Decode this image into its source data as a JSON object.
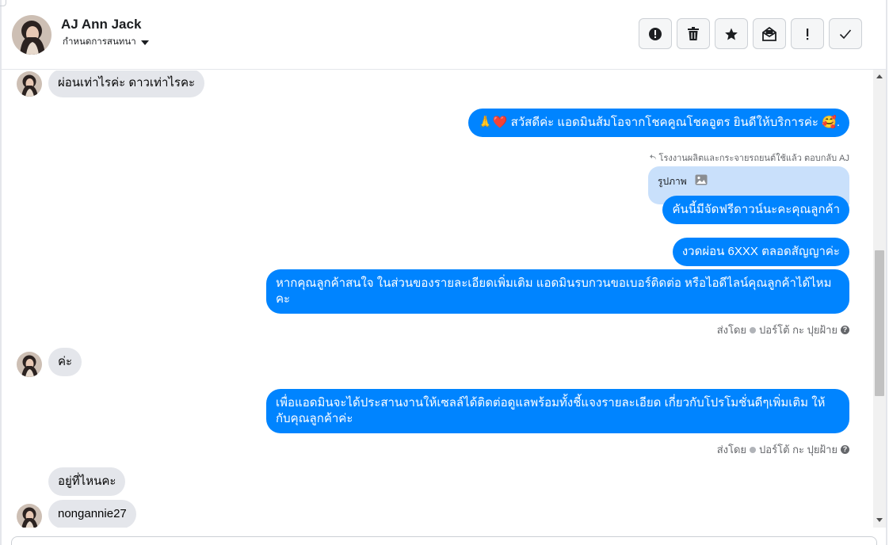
{
  "header": {
    "contact_name": "AJ Ann Jack",
    "assign_label": "กำหนดการสนทนา",
    "actions": [
      {
        "name": "report-button",
        "icon": "alert-circle-icon"
      },
      {
        "name": "delete-button",
        "icon": "trash-icon"
      },
      {
        "name": "star-button",
        "icon": "star-icon"
      },
      {
        "name": "mark-unread-button",
        "icon": "mail-open-icon"
      },
      {
        "name": "mark-important-button",
        "icon": "exclamation-icon"
      },
      {
        "name": "done-button",
        "icon": "checkmark-icon"
      }
    ]
  },
  "messages": {
    "m1": "ผ่อนเท่าไรค่ะ ดาวเท่าไรคะ",
    "m2": "🙏❤️ สวัสดีค่ะ แอดมินส้มโอจากโชคคูณโชคอูตร ยินดีให้บริการค่ะ 🥰.",
    "reply_note": "โรงงานผลิตและกระจายรถยนต์ใช้แล้ว ตอบกลับ AJ",
    "reply_quote": "รูปภาพ",
    "m3": "คันนี้มีจัดฟรีดาวน์นะคะคุณลูกค้า",
    "m4": "งวดผ่อน 6XXX ตลอดสัญญาค่ะ",
    "m5": "หากคุณลูกค้าสนใจ ในส่วนของรายละเอียดเพิ่มเติม แอดมินรบกวนขอเบอร์ติดต่อ หรือไอดีไลน์คุณลูกค้าได้ไหมคะ",
    "sent_by_1": "ส่งโดย",
    "sender_1": "ปอร์โต้ กะ ปุยฝ้าย",
    "m6": "ค่ะ",
    "m7": "เพื่อแอดมินจะได้ประสานงานให้เซลล์ได้ติดต่อดูแลพร้อมทั้งชี้แจงรายละเอียด เกี่ยวกับโปรโมชั่นดีๆเพิ่มเติม ให้กับคุณลูกค้าค่ะ",
    "sent_by_2": "ส่งโดย",
    "sender_2": "ปอร์โต้ กะ ปุยฝ้าย",
    "m8": "อยู่ที่ไหนคะ",
    "m9": "nongannie27"
  },
  "colors": {
    "outgoing_bubble": "#0084ff",
    "incoming_bubble": "#e4e6eb",
    "reply_quote": "#c9e0fb"
  }
}
